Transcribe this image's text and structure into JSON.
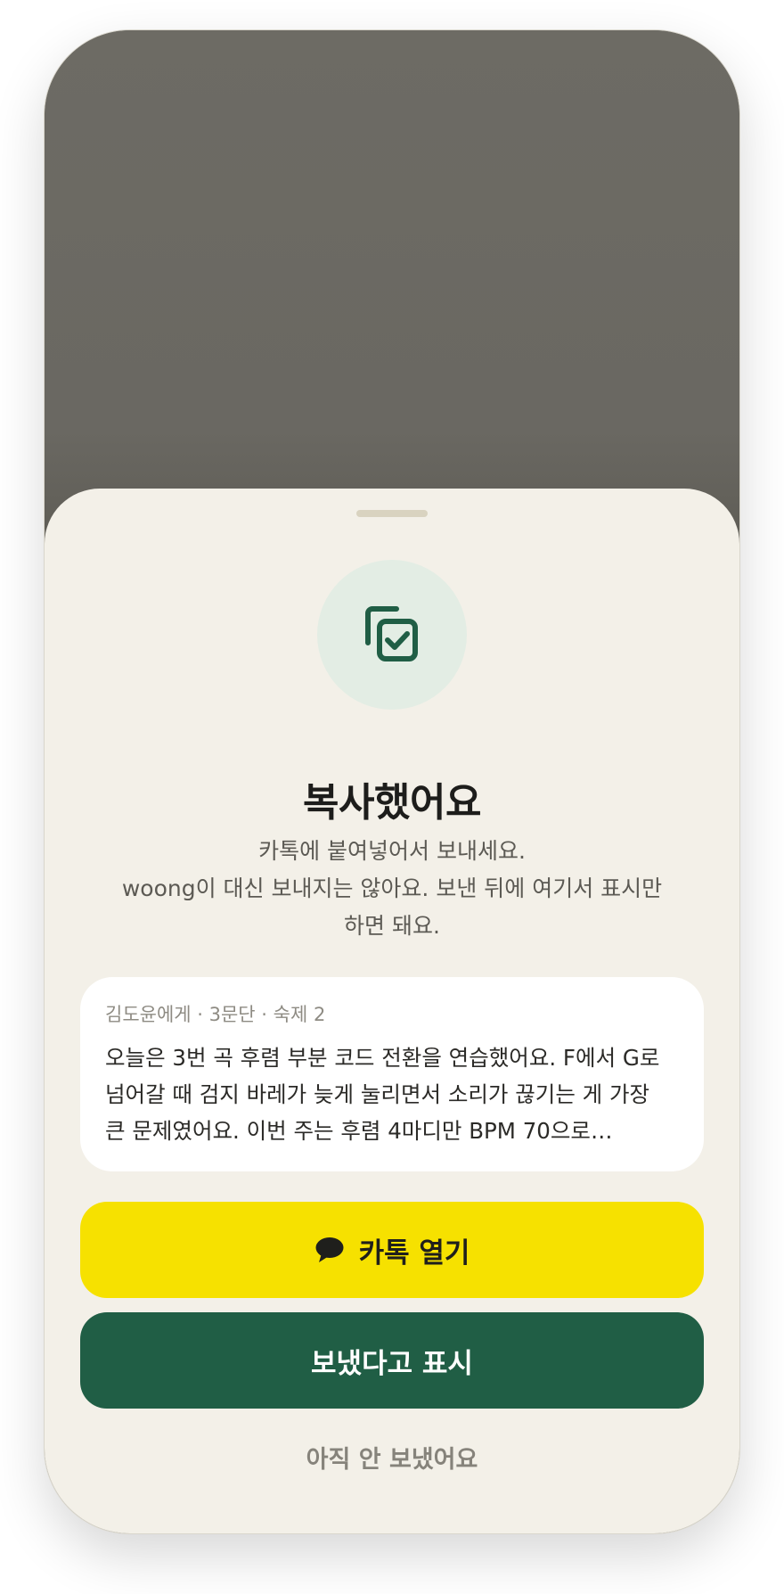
{
  "sheet": {
    "title": "복사했어요",
    "description_lines": [
      "카톡에 붙여넣어서 보내세요.",
      "woong이 대신 보내지는 않아요. 보낸 뒤에 여기서 표시만",
      "하면 돼요."
    ],
    "icon": "copy-check-icon"
  },
  "preview": {
    "meta": "김도윤에게 · 3문단 · 숙제 2",
    "lines": [
      "오늘은 3번 곡 후렴 부분 코드 전환을 연습했어요. F에서 G로",
      "넘어갈 때 검지 바레가 늦게 눌리면서 소리가 끊기는 게 가장",
      "큰 문제였어요. 이번 주는 후렴 4마디만 BPM 70으로…"
    ]
  },
  "actions": {
    "open_kakao_label": "카톡 열기",
    "open_kakao_icon": "chat-bubble-icon",
    "mark_sent_label": "보냈다고 표시",
    "not_sent_label": "아직 안 보냈어요"
  },
  "colors": {
    "kakao_yellow": "#f6e100",
    "primary_green": "#205e45",
    "sheet_bg": "#f3f0e8",
    "icon_circle_bg": "#e3ede4"
  }
}
